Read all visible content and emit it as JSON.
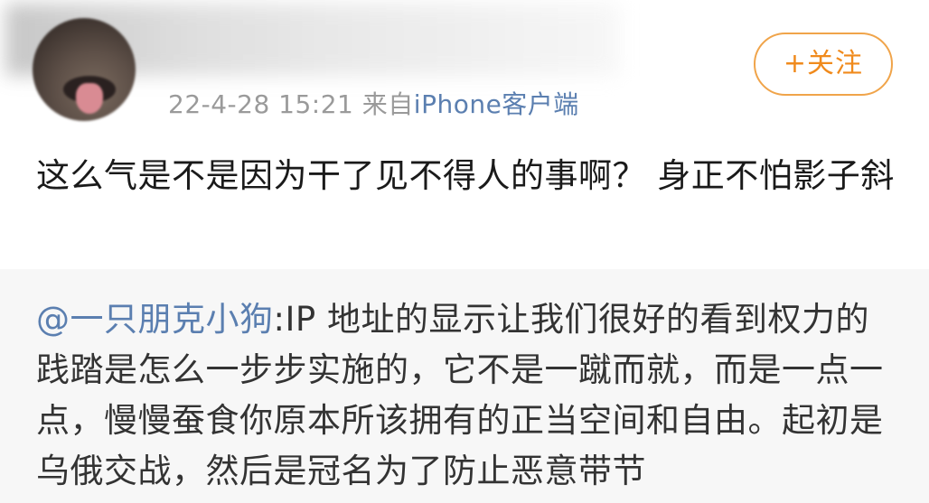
{
  "post": {
    "timestamp": "22-4-28 15:21",
    "source_prefix": "来自",
    "source_app": "iPhone客户端",
    "follow_label": "+关注",
    "text": "这么气是不是因为干了见不得人的事啊？ 身正不怕影子斜"
  },
  "repost": {
    "mention": "@一只朋克小狗",
    "separator": ":",
    "text": "IP 地址的显示让我们很好的看到权力的践踏是怎么一步步实施的，它不是一蹴而就，而是一点一点，慢慢蚕食你原本所该拥有的正当空间和自由。起初是乌俄交战，然后是冠名为了防止恶意带节"
  },
  "colors": {
    "link": "#5b7fb0",
    "follow_accent": "#f08a1c",
    "meta_gray": "#9a9a9a",
    "repost_bg": "#f7f7f7"
  }
}
